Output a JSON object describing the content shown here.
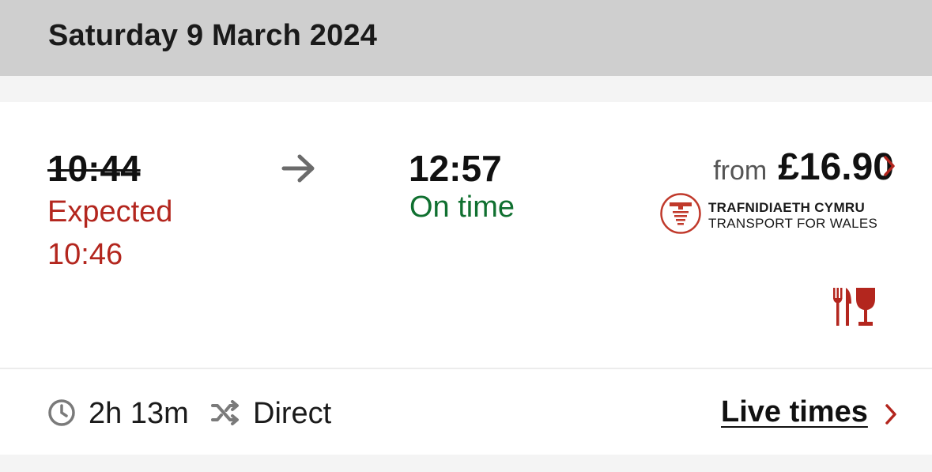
{
  "header": {
    "date": "Saturday 9 March 2024"
  },
  "journey": {
    "departure": {
      "scheduled": "10:44",
      "status_label": "Expected",
      "expected": "10:46"
    },
    "arrival": {
      "time": "12:57",
      "status": "On time"
    },
    "price": {
      "prefix": "from",
      "amount": "£16.90"
    },
    "operator": {
      "name_line1": "TRAFNIDIAETH CYMRU",
      "name_line2": "TRANSPORT FOR WALES"
    },
    "amenity_icon": "food-and-drink-icon",
    "duration": "2h 13m",
    "changes": "Direct",
    "live_times_label": "Live times"
  },
  "colors": {
    "header_bg": "#cfcfcf",
    "delayed": "#b3261e",
    "on_time": "#107030",
    "accent": "#b3261e"
  },
  "icons": [
    "arrow-right-icon",
    "chevron-right-icon",
    "clock-icon",
    "shuffle-icon",
    "fork-knife-glass-icon",
    "tfw-logo-icon"
  ]
}
